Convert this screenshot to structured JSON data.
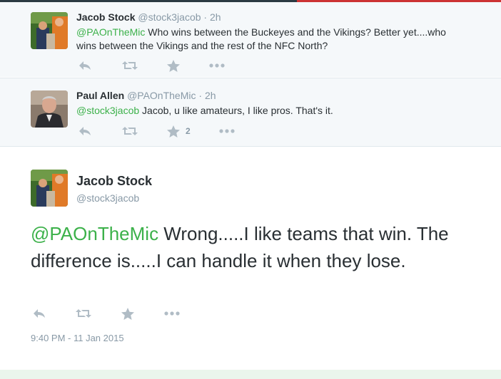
{
  "tweets": [
    {
      "name": "Jacob Stock",
      "handle": "@stock3jacob",
      "separator": "·",
      "time": "2h",
      "mention": "@PAOnTheMic",
      "text": " Who wins between the Buckeyes and the Vikings?  Better yet....who wins between the Vikings and the rest of the NFC North?",
      "favorite_count": ""
    },
    {
      "name": "Paul Allen",
      "handle": "@PAOnTheMic",
      "separator": "·",
      "time": "2h",
      "mention": "@stock3jacob",
      "text": " Jacob, u like amateurs, I like pros. That's it.",
      "favorite_count": "2"
    }
  ],
  "focused_tweet": {
    "name": "Jacob Stock",
    "handle": "@stock3jacob",
    "mention": "@PAOnTheMic",
    "text": " Wrong.....I like teams that win.  The difference is.....I can handle it when they lose.",
    "timestamp": "9:40 PM - 11 Jan 2015"
  },
  "icons": [
    "reply-icon",
    "retweet-icon",
    "favorite-icon",
    "more-icon"
  ],
  "colors": {
    "mention": "#3cb14a",
    "secondary_text": "#8899a6",
    "action_icon": "#b0bcc5",
    "reply_background": "#f5f8fa",
    "top_bar": "#2b3a42",
    "top_bar_accent": "#cc3333"
  }
}
